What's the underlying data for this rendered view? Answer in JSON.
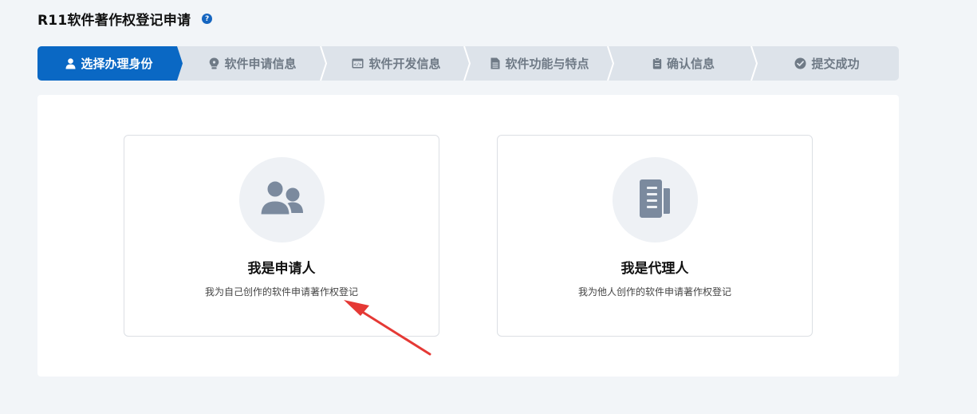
{
  "page": {
    "title": "R11软件著作权登记申请",
    "help_icon": "question-circle-icon"
  },
  "steps": [
    {
      "label": "选择办理身份",
      "icon": "user-icon",
      "active": true
    },
    {
      "label": "软件申请信息",
      "icon": "lightbulb-icon",
      "active": false
    },
    {
      "label": "软件开发信息",
      "icon": "code-window-icon",
      "active": false
    },
    {
      "label": "软件功能与特点",
      "icon": "document-icon",
      "active": false
    },
    {
      "label": "确认信息",
      "icon": "clipboard-icon",
      "active": false
    },
    {
      "label": "提交成功",
      "icon": "check-circle-icon",
      "active": false
    }
  ],
  "roles": [
    {
      "title": "我是申请人",
      "desc": "我为自己创作的软件申请著作权登记",
      "icon": "users-icon"
    },
    {
      "title": "我是代理人",
      "desc": "我为他人创作的软件申请著作权登记",
      "icon": "documents-icon"
    }
  ],
  "colors": {
    "active_step": "#0a68c4",
    "inactive_step": "#dde3ea",
    "annotation_arrow": "#e53935",
    "icon_gray": "#7b8a9e"
  }
}
